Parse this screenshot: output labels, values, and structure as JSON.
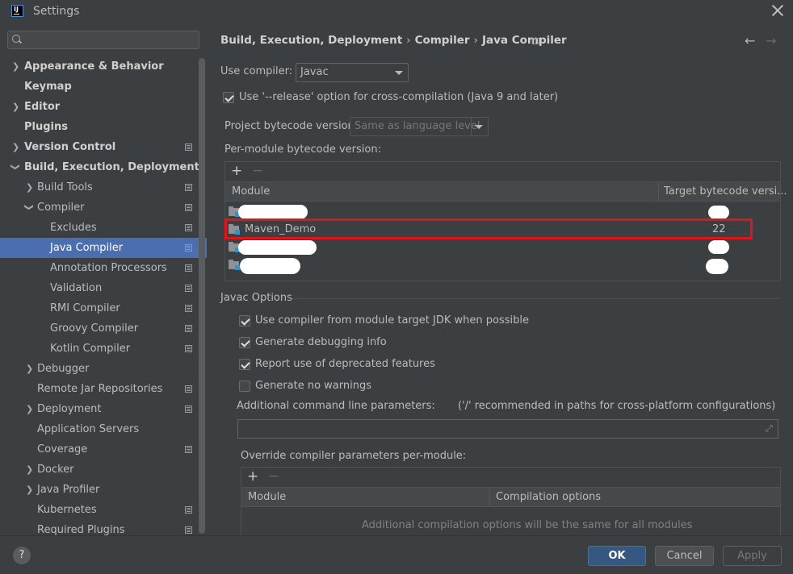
{
  "window": {
    "title": "Settings"
  },
  "search": {
    "placeholder": ""
  },
  "sidebar": {
    "items": [
      {
        "label": "Appearance & Behavior"
      },
      {
        "label": "Keymap"
      },
      {
        "label": "Editor"
      },
      {
        "label": "Plugins"
      },
      {
        "label": "Version Control"
      },
      {
        "label": "Build, Execution, Deployment"
      },
      {
        "label": "Build Tools"
      },
      {
        "label": "Compiler"
      },
      {
        "label": "Excludes"
      },
      {
        "label": "Java Compiler"
      },
      {
        "label": "Annotation Processors"
      },
      {
        "label": "Validation"
      },
      {
        "label": "RMI Compiler"
      },
      {
        "label": "Groovy Compiler"
      },
      {
        "label": "Kotlin Compiler"
      },
      {
        "label": "Debugger"
      },
      {
        "label": "Remote Jar Repositories"
      },
      {
        "label": "Deployment"
      },
      {
        "label": "Application Servers"
      },
      {
        "label": "Coverage"
      },
      {
        "label": "Docker"
      },
      {
        "label": "Java Profiler"
      },
      {
        "label": "Kubernetes"
      },
      {
        "label": "Required Plugins"
      }
    ]
  },
  "breadcrumb": [
    "Build, Execution, Deployment",
    "Compiler",
    "Java Compiler"
  ],
  "compiler": {
    "use_compiler_label": "Use compiler:",
    "use_compiler_value": "Javac",
    "release_option_label": "Use '--release' option for cross-compilation (Java 9 and later)",
    "release_option_checked": true,
    "bytecode_label": "Project bytecode version:",
    "bytecode_value": "Same as language level",
    "per_module_label": "Per-module bytecode version:",
    "module_table": {
      "plus": "+",
      "minus": "−",
      "col_module": "Module",
      "col_target": "Target bytecode versi...",
      "rows": [
        {
          "name": "",
          "target": "",
          "redacted": true
        },
        {
          "name": "Maven_Demo",
          "target": "22",
          "redacted": false,
          "highlighted": true
        },
        {
          "name": "",
          "target": "",
          "redacted": true
        },
        {
          "name": "",
          "target": "",
          "redacted": true
        }
      ]
    }
  },
  "javac_options": {
    "section_label": "Javac Options",
    "checkboxes": [
      {
        "label": "Use compiler from module target JDK when possible",
        "checked": true
      },
      {
        "label": "Generate debugging info",
        "checked": true
      },
      {
        "label": "Report use of deprecated features",
        "checked": true
      },
      {
        "label": "Generate no warnings",
        "checked": false
      }
    ],
    "additional_params_label": "Additional command line parameters:",
    "additional_params_hint": "('/' recommended in paths for cross-platform configurations)",
    "additional_params_value": "",
    "override_label": "Override compiler parameters per-module:",
    "override_table": {
      "plus": "+",
      "minus": "−",
      "col_module": "Module",
      "col_options": "Compilation options",
      "empty_text": "Additional compilation options will be the same for all modules"
    }
  },
  "footer": {
    "help": "?",
    "ok": "OK",
    "cancel": "Cancel",
    "apply": "Apply"
  },
  "colors": {
    "selection": "#4b6eaf",
    "ok_button": "#365880",
    "highlight_box": "#e0141a"
  }
}
